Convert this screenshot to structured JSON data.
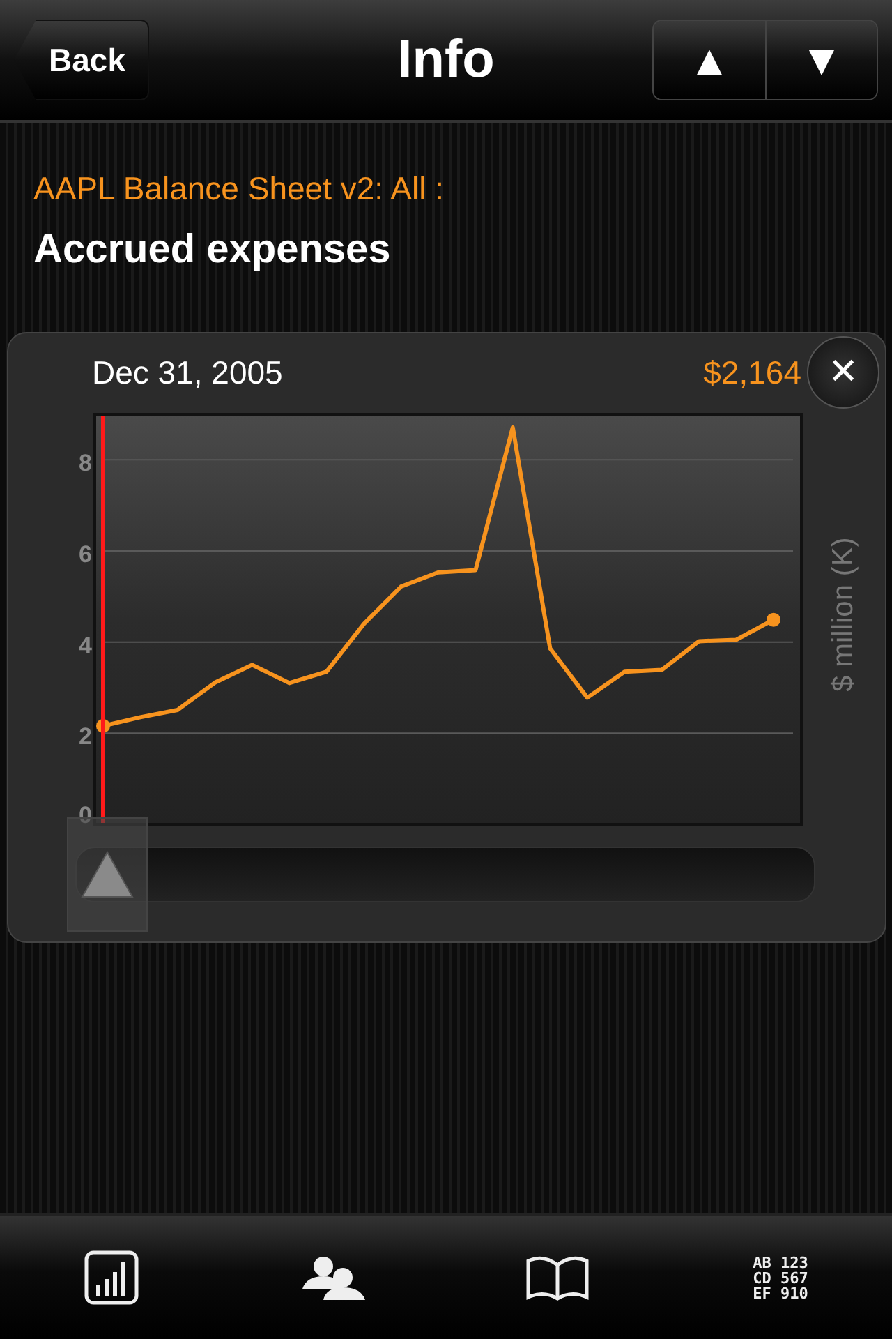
{
  "nav_bar": {
    "back": "Back",
    "title": "Info",
    "prev_symbol": "▲",
    "next_symbol": "▼"
  },
  "subtitle": "AAPL Balance Sheet v2: All :",
  "heading": "Accrued expenses",
  "chart_card": {
    "date": "Dec 31, 2005",
    "value": "$2,164",
    "close": "✕",
    "chart_data": {
      "type": "line",
      "ylabel": "$ million (K)",
      "ylim": [
        0,
        9
      ],
      "yticks": [
        0,
        2,
        4,
        6,
        8
      ],
      "grid": true,
      "series": [
        {
          "color": "#f7931e",
          "values": [
            2.16,
            2.35,
            2.51,
            3.11,
            3.5,
            3.1,
            3.35,
            4.4,
            5.22,
            5.53,
            5.58,
            8.71,
            3.86,
            2.78,
            3.35,
            3.39,
            4.02,
            4.05,
            4.49
          ]
        }
      ]
    },
    "scrubber": {
      "level": 0
    }
  },
  "tab_bar": [
    {
      "kind": "chart"
    },
    {
      "kind": "people"
    },
    {
      "kind": "book"
    },
    {
      "kind": "codes",
      "lines": [
        "AB 123",
        "CD 567",
        "EF 910"
      ]
    }
  ]
}
